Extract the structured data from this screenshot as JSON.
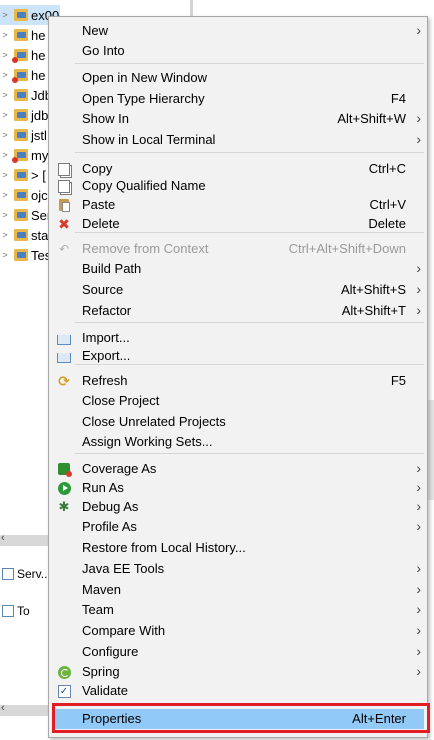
{
  "explorer": {
    "rows": [
      {
        "label": "ex00",
        "arrow": ">"
      },
      {
        "label": "he",
        "arrow": ">"
      },
      {
        "label": "he",
        "arrow": ">"
      },
      {
        "label": "he",
        "arrow": ">"
      },
      {
        "label": "Jdb",
        "arrow": ">"
      },
      {
        "label": "jdb",
        "arrow": ">"
      },
      {
        "label": "jstl",
        "arrow": ">"
      },
      {
        "label": "my",
        "arrow": ">"
      },
      {
        "label": "> [",
        "arrow": ">"
      },
      {
        "label": "ojc",
        "arrow": ">"
      },
      {
        "label": "Ser",
        "arrow": ">"
      },
      {
        "label": "sta",
        "arrow": ">"
      },
      {
        "label": "Tes",
        "arrow": ">"
      }
    ],
    "servers_tab": "Serv...",
    "tasks_tab": "To"
  },
  "menu": {
    "items": [
      {
        "label": "New",
        "shortcut": "",
        "submenu": true,
        "icon": ""
      },
      {
        "label": "Go Into",
        "shortcut": "",
        "submenu": false,
        "icon": ""
      },
      {
        "label": "Open in New Window",
        "shortcut": "",
        "submenu": false,
        "icon": ""
      },
      {
        "label": "Open Type Hierarchy",
        "shortcut": "F4",
        "submenu": false,
        "icon": ""
      },
      {
        "label": "Show In",
        "shortcut": "Alt+Shift+W",
        "submenu": true,
        "icon": ""
      },
      {
        "label": "Show in Local Terminal",
        "shortcut": "",
        "submenu": true,
        "icon": ""
      },
      {
        "label": "Copy",
        "shortcut": "Ctrl+C",
        "submenu": false,
        "icon": "copy-icon"
      },
      {
        "label": "Copy Qualified Name",
        "shortcut": "",
        "submenu": false,
        "icon": "copy-qualified-icon"
      },
      {
        "label": "Paste",
        "shortcut": "Ctrl+V",
        "submenu": false,
        "icon": "paste-icon"
      },
      {
        "label": "Delete",
        "shortcut": "Delete",
        "submenu": false,
        "icon": "delete-icon"
      },
      {
        "label": "Remove from Context",
        "shortcut": "Ctrl+Alt+Shift+Down",
        "submenu": false,
        "icon": "remove-icon",
        "disabled": true
      },
      {
        "label": "Build Path",
        "shortcut": "",
        "submenu": true,
        "icon": ""
      },
      {
        "label": "Source",
        "shortcut": "Alt+Shift+S",
        "submenu": true,
        "icon": ""
      },
      {
        "label": "Refactor",
        "shortcut": "Alt+Shift+T",
        "submenu": true,
        "icon": ""
      },
      {
        "label": "Import...",
        "shortcut": "",
        "submenu": false,
        "icon": "import-icon"
      },
      {
        "label": "Export...",
        "shortcut": "",
        "submenu": false,
        "icon": "export-icon"
      },
      {
        "label": "Refresh",
        "shortcut": "F5",
        "submenu": false,
        "icon": "refresh-icon"
      },
      {
        "label": "Close Project",
        "shortcut": "",
        "submenu": false,
        "icon": ""
      },
      {
        "label": "Close Unrelated Projects",
        "shortcut": "",
        "submenu": false,
        "icon": ""
      },
      {
        "label": "Assign Working Sets...",
        "shortcut": "",
        "submenu": false,
        "icon": ""
      },
      {
        "label": "Coverage As",
        "shortcut": "",
        "submenu": true,
        "icon": "coverage-icon"
      },
      {
        "label": "Run As",
        "shortcut": "",
        "submenu": true,
        "icon": "run-icon"
      },
      {
        "label": "Debug As",
        "shortcut": "",
        "submenu": true,
        "icon": "debug-icon"
      },
      {
        "label": "Profile As",
        "shortcut": "",
        "submenu": true,
        "icon": ""
      },
      {
        "label": "Restore from Local History...",
        "shortcut": "",
        "submenu": false,
        "icon": ""
      },
      {
        "label": "Java EE Tools",
        "shortcut": "",
        "submenu": true,
        "icon": ""
      },
      {
        "label": "Maven",
        "shortcut": "",
        "submenu": true,
        "icon": ""
      },
      {
        "label": "Team",
        "shortcut": "",
        "submenu": true,
        "icon": ""
      },
      {
        "label": "Compare With",
        "shortcut": "",
        "submenu": true,
        "icon": ""
      },
      {
        "label": "Configure",
        "shortcut": "",
        "submenu": true,
        "icon": ""
      },
      {
        "label": "Spring",
        "shortcut": "",
        "submenu": true,
        "icon": "spring-icon"
      },
      {
        "label": "Validate",
        "shortcut": "",
        "submenu": false,
        "icon": "validate-icon"
      },
      {
        "label": "Properties",
        "shortcut": "Alt+Enter",
        "submenu": false,
        "icon": "",
        "highlighted": true
      }
    ]
  },
  "colors": {
    "highlight_bg": "#91c9f7",
    "annotation_border": "#e11d26",
    "menu_bg": "#f2f2f2"
  }
}
